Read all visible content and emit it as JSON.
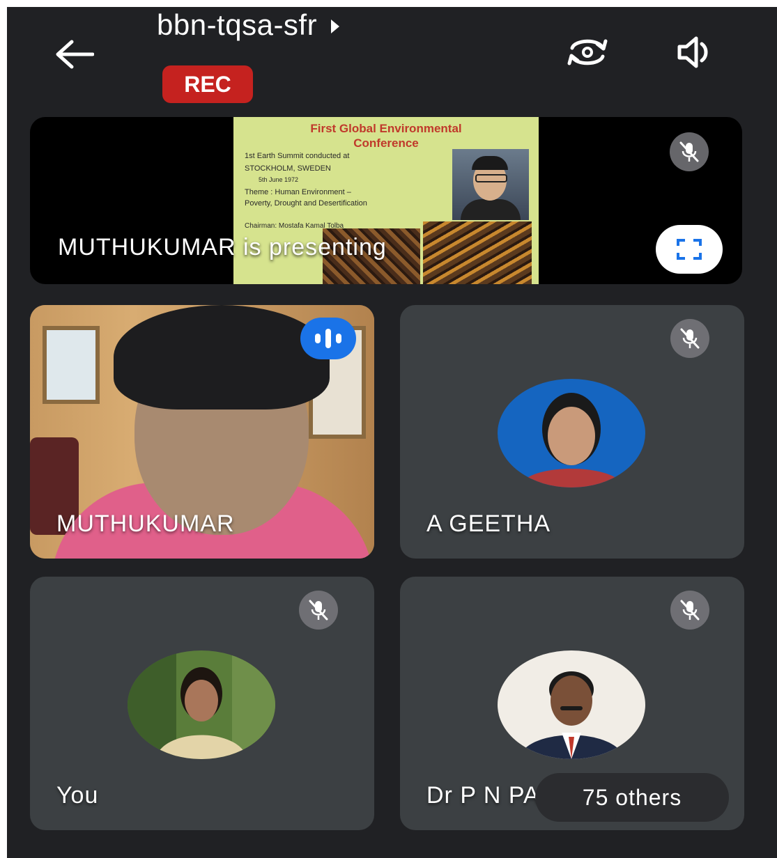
{
  "header": {
    "meeting_code": "bbn-tqsa-sfr",
    "rec_label": "REC",
    "back_icon": "arrow-left-icon",
    "flip_icon": "camera-flip-icon",
    "audio_icon": "speaker-icon"
  },
  "presentation": {
    "label": "MUTHUKUMAR is presenting",
    "slide": {
      "title_line1": "First Global Environmental",
      "title_line2": "Conference",
      "line1": "1st Earth Summit conducted at",
      "line2": "STOCKHOLM, SWEDEN",
      "line3": "5th June 1972",
      "line4": "Theme : Human Environment –",
      "line5": "Poverty, Drought and Desertification",
      "line6": "Chairman: Mostafa Kamal Tolba"
    },
    "mic_icon": "mic-off-icon",
    "fullscreen_icon": "fullscreen-icon"
  },
  "participants": [
    {
      "name": "MUTHUKUMAR",
      "status": "speaking"
    },
    {
      "name": "A GEETHA",
      "status": "muted"
    },
    {
      "name": "You",
      "status": "muted"
    },
    {
      "name": "Dr P N PALANISAMY",
      "status": "muted"
    }
  ],
  "others_label": "75 others",
  "colors": {
    "background": "#202124",
    "tile": "#3c4043",
    "rec": "#c5221f",
    "speaking": "#1a73e8"
  }
}
